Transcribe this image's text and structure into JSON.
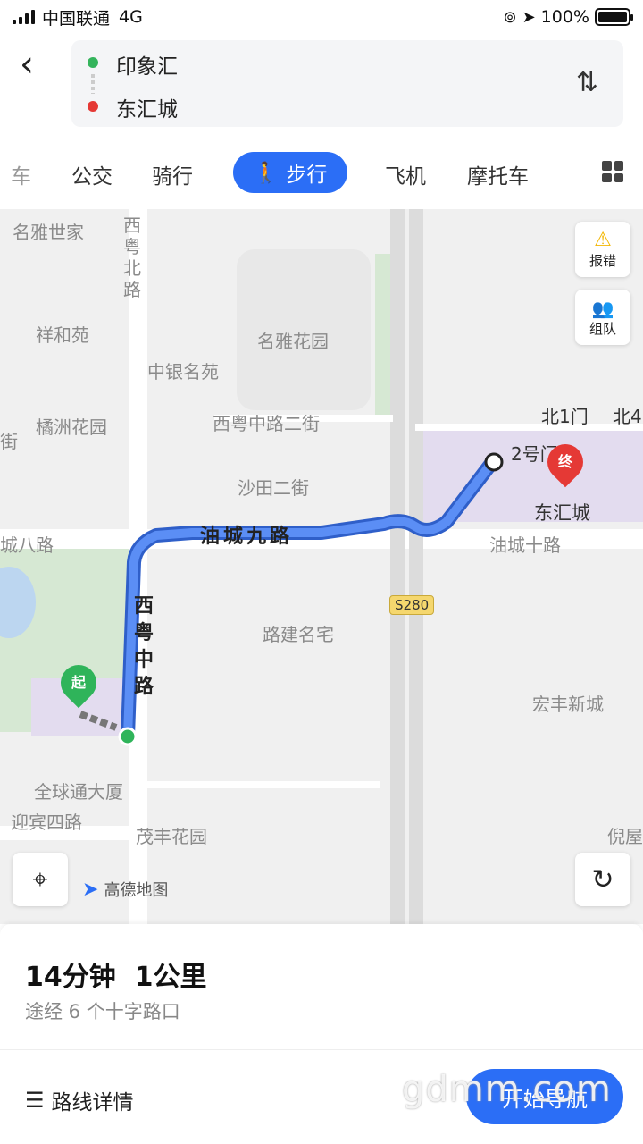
{
  "status_bar": {
    "carrier": "中国联通",
    "network": "4G",
    "battery": "100%"
  },
  "route": {
    "origin": "印象汇",
    "destination": "东汇城"
  },
  "tabs": [
    "车",
    "公交",
    "骑行",
    "步行",
    "飞机",
    "摩托车"
  ],
  "active_tab": "步行",
  "map": {
    "labels": [
      "名雅世家",
      "西粤北路",
      "祥和苑",
      "名雅花园",
      "中银名苑",
      "橘洲花园",
      "西粤中路二街",
      "沙田二街",
      "城八路",
      "油城十路",
      "路建名宅",
      "宏丰新城",
      "全球通大厦",
      "迎宾四路",
      "茂丰花园",
      "倪屋",
      "街",
      "北1门",
      "北4",
      "2号门"
    ],
    "road_labels": {
      "youcheng9": "油城九路",
      "xiyue_zhong": "西粤中路"
    },
    "highway_badge": "S280",
    "destination_label": "东汇城",
    "start_pin": "起",
    "end_pin": "终",
    "report_label": "报错",
    "team_label": "组队",
    "logo_text": "高德地图",
    "route_color": "#3b78f0",
    "start_color": "#2fb45a",
    "end_color": "#e53935"
  },
  "summary": {
    "time": "14分钟",
    "distance": "1公里",
    "via": "途经 6 个十字路口"
  },
  "actions": {
    "details": "路线详情",
    "start_nav": "开始导航"
  },
  "watermark": "gdmm.com"
}
